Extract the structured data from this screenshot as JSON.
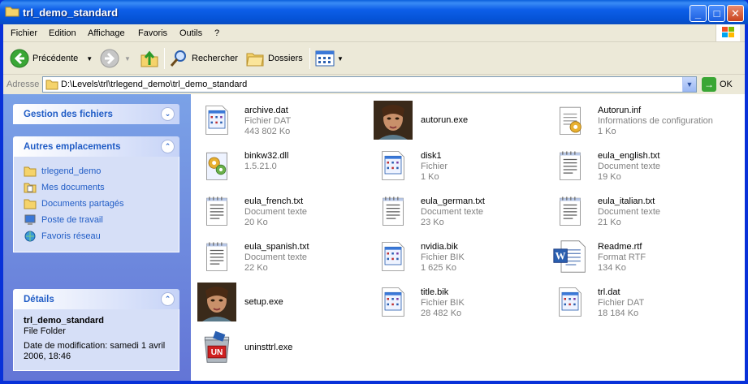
{
  "window": {
    "title": "trl_demo_standard",
    "minimize": "_",
    "maximize": "□",
    "close": "✕"
  },
  "menu": [
    "Fichier",
    "Edition",
    "Affichage",
    "Favoris",
    "Outils",
    "?"
  ],
  "toolbar": {
    "back": "Précédente",
    "search": "Rechercher",
    "folders": "Dossiers"
  },
  "address": {
    "label": "Adresse",
    "value": "D:\\Levels\\trl\\trlegend_demo\\trl_demo_standard",
    "go": "OK"
  },
  "sidebar": {
    "file_tasks": {
      "title": "Gestion des fichiers"
    },
    "other_places": {
      "title": "Autres emplacements",
      "items": [
        {
          "label": "trlegend_demo",
          "icon": "folder-icon"
        },
        {
          "label": "Mes documents",
          "icon": "my-documents-icon"
        },
        {
          "label": "Documents partagés",
          "icon": "shared-folder-icon"
        },
        {
          "label": "Poste de travail",
          "icon": "my-computer-icon"
        },
        {
          "label": "Favoris réseau",
          "icon": "network-places-icon"
        }
      ]
    },
    "details": {
      "title": "Détails",
      "name": "trl_demo_standard",
      "type": "File Folder",
      "modified": "Date de modification: samedi 1 avril 2006, 18:46"
    }
  },
  "files": [
    {
      "name": "archive.dat",
      "type": "Fichier DAT",
      "size": "443 802 Ko",
      "icon": "generic-file-icon"
    },
    {
      "name": "autorun.exe",
      "type": "",
      "size": "",
      "icon": "lara-app-icon"
    },
    {
      "name": "Autorun.inf",
      "type": "Informations de configuration",
      "size": "1 Ko",
      "icon": "config-file-icon"
    },
    {
      "name": "binkw32.dll",
      "type": "1.5.21.0",
      "size": "",
      "icon": "dll-file-icon"
    },
    {
      "name": "disk1",
      "type": "Fichier",
      "size": "1 Ko",
      "icon": "generic-file-icon"
    },
    {
      "name": "eula_english.txt",
      "type": "Document texte",
      "size": "19 Ko",
      "icon": "text-file-icon"
    },
    {
      "name": "eula_french.txt",
      "type": "Document texte",
      "size": "20 Ko",
      "icon": "text-file-icon"
    },
    {
      "name": "eula_german.txt",
      "type": "Document texte",
      "size": "23 Ko",
      "icon": "text-file-icon"
    },
    {
      "name": "eula_italian.txt",
      "type": "Document texte",
      "size": "21 Ko",
      "icon": "text-file-icon"
    },
    {
      "name": "eula_spanish.txt",
      "type": "Document texte",
      "size": "22 Ko",
      "icon": "text-file-icon"
    },
    {
      "name": "nvidia.bik",
      "type": "Fichier BIK",
      "size": "1 625 Ko",
      "icon": "generic-file-icon"
    },
    {
      "name": "Readme.rtf",
      "type": "Format RTF",
      "size": "134 Ko",
      "icon": "word-rtf-icon"
    },
    {
      "name": "setup.exe",
      "type": "",
      "size": "",
      "icon": "lara-app-icon"
    },
    {
      "name": "title.bik",
      "type": "Fichier BIK",
      "size": "28 482 Ko",
      "icon": "generic-file-icon"
    },
    {
      "name": "trl.dat",
      "type": "Fichier DAT",
      "size": "18 184 Ko",
      "icon": "generic-file-icon"
    },
    {
      "name": "uninsttrl.exe",
      "type": "",
      "size": "",
      "icon": "uninstall-icon"
    }
  ]
}
